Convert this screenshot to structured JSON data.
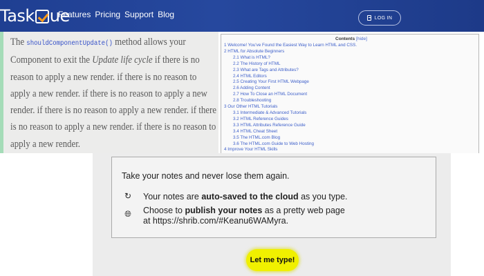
{
  "colors": {
    "nav_bg": "#26489e",
    "logo_accent": "#ff9c1a",
    "article_bg": "#ececeb",
    "article_border": "#a5dcb8",
    "code_text": "#3651c8",
    "toc_link": "#3c5ec9",
    "cta_bg": "#f0f000"
  },
  "nav": {
    "logo_pre": "Task",
    "logo_post": "ue",
    "links": [
      "Features",
      "Pricing",
      "Support",
      "Blog"
    ],
    "login_label": "LOG IN",
    "login_icon": "login-icon"
  },
  "article": {
    "p1": "The ",
    "code": "shouldComponentUpdate()",
    "p2": " method allows your Component to exit the ",
    "em": "Update life cycle",
    "p3": " if there is no reason to apply a new render. if there is no reason to apply a new render. if there is no reason to apply a new render. if there is no reason to apply a new render. if there is no reason to apply a new render. if there is no reason to apply a new render."
  },
  "toc": {
    "title": "Contents",
    "hide": "[hide]",
    "items": [
      {
        "text": "1 Welcome! You've Found the Easiest Way to Learn HTML and CSS.",
        "level": 1
      },
      {
        "text": "2 HTML for Absolute Beginners",
        "level": 1
      },
      {
        "text": "2.1 What is HTML?",
        "level": 2
      },
      {
        "text": "2.2 The History of HTML",
        "level": 2
      },
      {
        "text": "2.3 What are Tags and Attributes?",
        "level": 2
      },
      {
        "text": "2.4 HTML Editors",
        "level": 2
      },
      {
        "text": "2.5 Creating Your First HTML Webpage",
        "level": 2
      },
      {
        "text": "2.6 Adding Content",
        "level": 2
      },
      {
        "text": "2.7 How To Close an HTML Document",
        "level": 2
      },
      {
        "text": "2.8 Troubleshooting",
        "level": 2
      },
      {
        "text": "3 Our Other HTML Tutorials",
        "level": 1
      },
      {
        "text": "3.1 Intermediate & Advanced Tutorials",
        "level": 2
      },
      {
        "text": "3.2 HTML Reference Guides",
        "level": 2
      },
      {
        "text": "3.3 HTML Attributes Reference Guide",
        "level": 2
      },
      {
        "text": "3.4 HTML Cheat Sheet",
        "level": 2
      },
      {
        "text": "3.5 The HTML.com Blog",
        "level": 2
      },
      {
        "text": "3.6 The HTML.com Guide to Web Hosting",
        "level": 2
      },
      {
        "text": "4 Improve Your HTML Skills",
        "level": 1
      }
    ]
  },
  "notes": {
    "title": "Take your notes and never lose them again.",
    "feature1_icon": "sync-icon",
    "feature1_pre": "Your notes are ",
    "feature1_bold": "auto-saved to the cloud",
    "feature1_post": " as you type.",
    "feature2_icon": "globe-icon",
    "feature2_pre": "Choose to ",
    "feature2_bold": "publish your notes",
    "feature2_post": " as a pretty web page at https://shrib.com/#Keanu6WAMyra.",
    "cta_label": "Let me type!"
  }
}
